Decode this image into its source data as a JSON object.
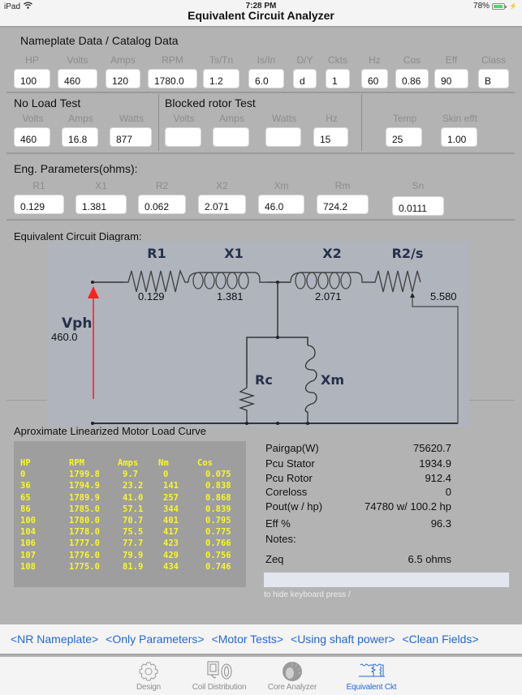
{
  "status_bar": {
    "device": "iPad",
    "time": "7:28 PM",
    "battery": "78%",
    "battery_level_pct": 78
  },
  "app": {
    "title": "Equivalent Circuit Analyzer"
  },
  "nameplate": {
    "title": "Nameplate Data / Catalog Data",
    "fields": [
      {
        "label": "HP",
        "value": "100"
      },
      {
        "label": "Volts",
        "value": "460"
      },
      {
        "label": "Amps",
        "value": "120"
      },
      {
        "label": "RPM",
        "value": "1780.0"
      },
      {
        "label": "Ts/Tn",
        "value": "1.2"
      },
      {
        "label": "Is/In",
        "value": "6.0"
      },
      {
        "label": "D/Y",
        "value": "d"
      },
      {
        "label": "Ckts",
        "value": "1"
      },
      {
        "label": "Hz",
        "value": "60"
      },
      {
        "label": "Cos",
        "value": "0.86"
      },
      {
        "label": "Eff",
        "value": "90"
      },
      {
        "label": "Class",
        "value": "B"
      }
    ]
  },
  "no_load": {
    "title": "No Load Test",
    "fields": [
      {
        "label": "Volts",
        "value": "460"
      },
      {
        "label": "Amps",
        "value": "16.8"
      },
      {
        "label": "Watts",
        "value": "877"
      }
    ]
  },
  "blocked_rotor": {
    "title": "Blocked rotor Test",
    "fields": [
      {
        "label": "Volts",
        "value": ""
      },
      {
        "label": "Amps",
        "value": ""
      },
      {
        "label": "Watts",
        "value": ""
      },
      {
        "label": "Hz",
        "value": "15"
      }
    ]
  },
  "extra": {
    "fields": [
      {
        "label": "Temp",
        "value": "25"
      },
      {
        "label": "Skin efft",
        "value": "1.00"
      }
    ]
  },
  "eng_params": {
    "title": "Eng. Parameters(ohms):",
    "fields": [
      {
        "label": "R1",
        "value": "0.129"
      },
      {
        "label": "X1",
        "value": "1.381"
      },
      {
        "label": "R2",
        "value": "0.062"
      },
      {
        "label": "X2",
        "value": "2.071"
      },
      {
        "label": "Xm",
        "value": "46.0"
      },
      {
        "label": "Rm",
        "value": "724.2"
      },
      {
        "label": "Sn",
        "value": "0.0111"
      }
    ]
  },
  "diagram": {
    "title": "Equivalent Circuit Diagram:",
    "labels": {
      "r1": "R1",
      "x1": "X1",
      "x2": "X2",
      "r2s": "R2/s",
      "vph": "Vph",
      "rc": "Rc",
      "xm": "Xm"
    },
    "values": {
      "r1": "0.129",
      "x1": "1.381",
      "x2": "2.071",
      "r2s": "5.580",
      "vph": "460.0"
    },
    "colors": {
      "source_arrow": "#ff2020",
      "wire": "#333333"
    }
  },
  "load_curve": {
    "title": "Aproximate Linearized Motor Load Curve",
    "columns": [
      "HP",
      "RPM",
      "Amps",
      "Nm",
      "Cos"
    ],
    "rows": [
      [
        "0",
        "1799.8",
        "9.7",
        "0",
        "0.075"
      ],
      [
        "36",
        "1794.9",
        "23.2",
        "141",
        "0.838"
      ],
      [
        "65",
        "1789.9",
        "41.0",
        "257",
        "0.868"
      ],
      [
        "86",
        "1785.0",
        "57.1",
        "344",
        "0.839"
      ],
      [
        "100",
        "1780.0",
        "70.7",
        "401",
        "0.795"
      ],
      [
        "104",
        "1778.0",
        "75.5",
        "417",
        "0.775"
      ],
      [
        "106",
        "1777.0",
        "77.7",
        "423",
        "0.766"
      ],
      [
        "107",
        "1776.0",
        "79.9",
        "429",
        "0.756"
      ],
      [
        "108",
        "1775.0",
        "81.9",
        "434",
        "0.746"
      ]
    ],
    "text_color": "#f7f72a"
  },
  "results": {
    "rows": [
      {
        "label": "Pairgap(W)",
        "value": "75620.7"
      },
      {
        "label": "Pcu Stator",
        "value": "1934.9"
      },
      {
        "label": "Pcu Rotor",
        "value": "912.4"
      },
      {
        "label": "Coreloss",
        "value": "0"
      },
      {
        "label": "Pout(w / hp)",
        "value": "74780 w/ 100.2 hp"
      },
      {
        "label": "Eff %",
        "value": "96.3"
      },
      {
        "label": "Notes:",
        "value": ""
      },
      {
        "label": "Zeq",
        "value": "6.5 ohms"
      }
    ],
    "notes_value": "",
    "hint": "to hide keyboard press  /"
  },
  "links": [
    "<NR Nameplate>",
    "<Only Parameters>",
    "<Motor Tests>",
    "<Using shaft power>",
    "<Clean Fields>"
  ],
  "tabs": [
    {
      "label": "Design",
      "icon": "gear-icon",
      "active": false
    },
    {
      "label": "Coil Distribution",
      "icon": "coil-icon",
      "active": false
    },
    {
      "label": "Core Analyzer",
      "icon": "stator-core-icon",
      "active": false
    },
    {
      "label": "Equivalent Ckt",
      "icon": "circuit-icon",
      "active": true
    }
  ],
  "accent_color": "#2468d8"
}
